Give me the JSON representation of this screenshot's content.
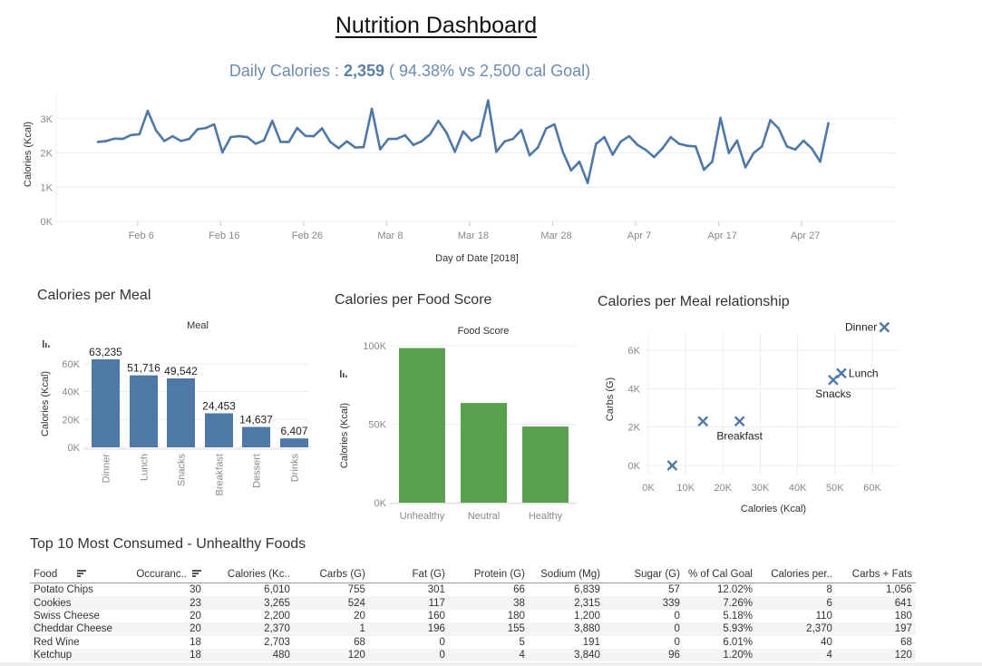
{
  "header": {
    "title": "Nutrition Dashboard",
    "subtitle_prefix": "Daily Calories : ",
    "subtitle_value": "2,359",
    "subtitle_suffix": " ( 94.38% vs 2,500 cal Goal)"
  },
  "colors": {
    "line": "#4e79a7",
    "bar_meal": "#4e79a7",
    "bar_score": "#59a14f",
    "scatter": "#4e79a7",
    "grid": "#ececec"
  },
  "chart_data": [
    {
      "id": "daily-calories",
      "type": "line",
      "title": "Daily Calories",
      "xlabel": "Day of Date [2018]",
      "ylabel": "Calories (Kcal)",
      "x_start": "2018-02-01",
      "x_ticks": [
        "Feb 6",
        "Feb 16",
        "Feb 26",
        "Mar 8",
        "Mar 18",
        "Mar 28",
        "Apr 7",
        "Apr 17",
        "Apr 27"
      ],
      "x_tick_day_offsets": [
        5,
        15,
        25,
        35,
        45,
        55,
        65,
        75,
        85
      ],
      "y_ticks": [
        "0K",
        "1K",
        "2K",
        "3K"
      ],
      "ylim": [
        0,
        3700
      ],
      "grid": true,
      "values": [
        2324,
        2350,
        2420,
        2410,
        2525,
        2550,
        3230,
        2660,
        2350,
        2490,
        2350,
        2410,
        2695,
        2730,
        2835,
        2020,
        2465,
        2490,
        2465,
        2270,
        2370,
        2940,
        2324,
        2324,
        2730,
        2500,
        2490,
        2720,
        2324,
        2140,
        2340,
        2160,
        2170,
        3290,
        2105,
        2410,
        2410,
        2520,
        2235,
        2340,
        2545,
        2940,
        2590,
        2035,
        2630,
        2360,
        2500,
        3535,
        2035,
        2340,
        2410,
        2675,
        1930,
        2160,
        2720,
        2835,
        2035,
        1490,
        1745,
        1125,
        2265,
        2465,
        1950,
        2340,
        2490,
        2235,
        2090,
        1880,
        2130,
        2465,
        2270,
        2210,
        2190,
        1510,
        1745,
        3025,
        2000,
        2360,
        1580,
        2000,
        2190,
        2960,
        2720,
        2190,
        2100,
        2360,
        2130,
        1745,
        2870
      ]
    },
    {
      "id": "calories-per-meal",
      "type": "bar",
      "title": "Calories per Meal",
      "header": "Meal",
      "ylabel": "Calories (Kcal)",
      "categories": [
        "Dinner",
        "Lunch",
        "Snacks",
        "Breakfast",
        "Dessert",
        "Drinks"
      ],
      "values": [
        63235,
        51716,
        49542,
        24453,
        14637,
        6407
      ],
      "labels": [
        "63,235",
        "51,716",
        "49,542",
        "24,453",
        "14,637",
        "6,407"
      ],
      "y_ticks": [
        "0K",
        "20K",
        "40K",
        "60K"
      ],
      "ylim": [
        0,
        65000
      ]
    },
    {
      "id": "calories-per-food-score",
      "type": "bar",
      "title": "Calories per Food Score",
      "header": "Food Score",
      "ylabel": "Calories (Kcal)",
      "categories": [
        "Unhealthy",
        "Neutral",
        "Healthy"
      ],
      "values": [
        98500,
        63500,
        48500
      ],
      "y_ticks": [
        "0K",
        "50K",
        "100K"
      ],
      "ylim": [
        0,
        100000
      ]
    },
    {
      "id": "calories-per-meal-relationship",
      "type": "scatter",
      "title": "Calories per Meal relationship",
      "xlabel": "Calories (Kcal)",
      "ylabel": "Carbs (G)",
      "x_ticks": [
        "0K",
        "10K",
        "20K",
        "30K",
        "40K",
        "50K",
        "60K"
      ],
      "y_ticks": [
        "0K",
        "2K",
        "4K",
        "6K"
      ],
      "xlim": [
        0,
        66000
      ],
      "ylim": [
        -400,
        7600
      ],
      "points": [
        {
          "label": "Dinner",
          "x": 63235,
          "y": 7200,
          "show_label": true,
          "label_pos": "left"
        },
        {
          "label": "Lunch",
          "x": 51716,
          "y": 4800,
          "show_label": true,
          "label_pos": "right"
        },
        {
          "label": "Snacks",
          "x": 49542,
          "y": 4450,
          "show_label": true,
          "label_pos": "below"
        },
        {
          "label": "Breakfast",
          "x": 24453,
          "y": 2300,
          "show_label": true,
          "label_pos": "below"
        },
        {
          "label": "Dessert",
          "x": 14637,
          "y": 2300,
          "show_label": false,
          "label_pos": "none"
        },
        {
          "label": "Drinks",
          "x": 6407,
          "y": 0,
          "show_label": false,
          "label_pos": "none"
        }
      ]
    }
  ],
  "table": {
    "title": "Top 10 Most Consumed - Unhealthy Foods",
    "columns": [
      "Food",
      "Occuranc..",
      "Calories (Kc..",
      "Carbs (G)",
      "Fat (G)",
      "Protein (G)",
      "Sodium (Mg)",
      "Sugar (G)",
      "% of Cal Goal",
      "Calories per..",
      "Carbs + Fats"
    ],
    "rows": [
      [
        "Potato Chips",
        "30",
        "6,010",
        "755",
        "301",
        "66",
        "6,839",
        "57",
        "12.02%",
        "8",
        "1,056"
      ],
      [
        "Cookies",
        "23",
        "3,265",
        "524",
        "117",
        "38",
        "2,315",
        "339",
        "7.26%",
        "6",
        "641"
      ],
      [
        "Swiss Cheese",
        "20",
        "2,200",
        "20",
        "160",
        "180",
        "1,200",
        "0",
        "5.18%",
        "110",
        "180"
      ],
      [
        "Cheddar Cheese",
        "20",
        "2,370",
        "1",
        "196",
        "155",
        "3,880",
        "0",
        "5.93%",
        "2,370",
        "197"
      ],
      [
        "Red Wine",
        "18",
        "2,703",
        "68",
        "0",
        "5",
        "191",
        "0",
        "6.01%",
        "40",
        "68"
      ],
      [
        "Ketchup",
        "18",
        "480",
        "120",
        "0",
        "4",
        "3,840",
        "96",
        "1.20%",
        "4",
        "120"
      ]
    ]
  }
}
